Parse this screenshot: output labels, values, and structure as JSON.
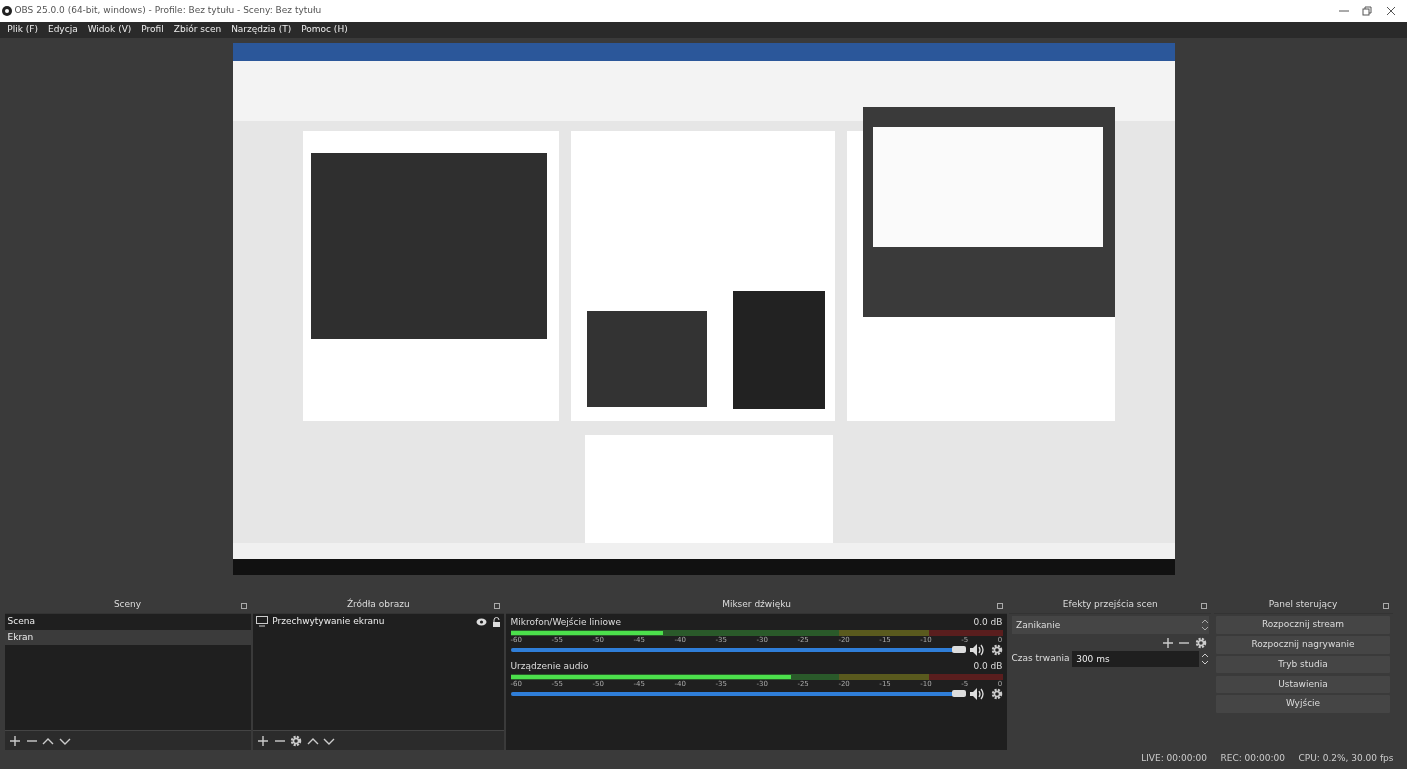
{
  "window": {
    "title": "OBS 25.0.0 (64-bit, windows) - Profile: Bez tytułu - Sceny: Bez tytułu"
  },
  "menu": [
    "Plik (F)",
    "Edycja",
    "Widok (V)",
    "Profil",
    "Zbiór scen",
    "Narzędzia (T)",
    "Pomoc (H)"
  ],
  "scenes": {
    "title": "Sceny",
    "items": [
      {
        "label": "Scena",
        "selected": false
      },
      {
        "label": "Ekran",
        "selected": true
      }
    ]
  },
  "sources": {
    "title": "Źródła obrazu",
    "items": [
      {
        "label": "Przechwytywanie ekranu",
        "visible": true,
        "locked": false
      }
    ]
  },
  "mixer": {
    "title": "Mikser dźwięku",
    "channels": [
      {
        "name": "Mikrofon/Wejście liniowe",
        "reading": "0.0 dB",
        "level": 0.31,
        "ticks": [
          "-60",
          "-55",
          "-50",
          "-45",
          "-40",
          "-35",
          "-30",
          "-25",
          "-20",
          "-15",
          "-10",
          "-5",
          "0"
        ],
        "volume": {
          "level": 1.0
        }
      },
      {
        "name": "Urządzenie audio",
        "reading": "0.0 dB",
        "level": 0.57,
        "ticks": [
          "-60",
          "-55",
          "-50",
          "-45",
          "-40",
          "-35",
          "-30",
          "-25",
          "-20",
          "-15",
          "-10",
          "-5",
          "0"
        ],
        "volume": {
          "level": 1.0
        }
      }
    ]
  },
  "transitions": {
    "title": "Efekty przejścia scen",
    "selected": "Zanikanie",
    "duration_label": "Czas trwania",
    "duration": "300 ms"
  },
  "controls": {
    "title": "Panel sterujący",
    "buttons": [
      "Rozpocznij stream",
      "Rozpocznij nagrywanie",
      "Tryb studia",
      "Ustawienia",
      "Wyjście"
    ]
  },
  "status_bar": [
    "LIVE: 00:00:00",
    "REC: 00:00:00",
    "CPU: 0.2%, 30.00 fps"
  ]
}
